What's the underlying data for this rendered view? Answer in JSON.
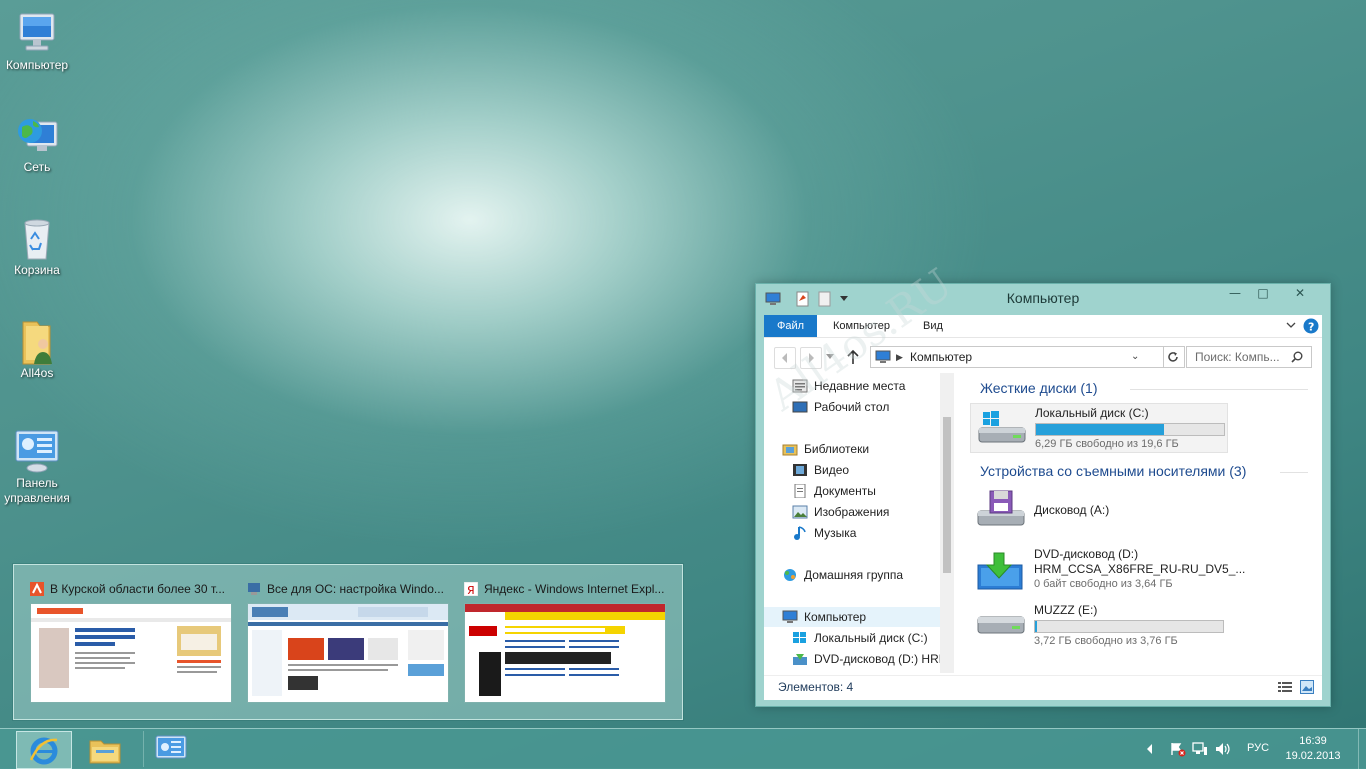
{
  "desktop": {
    "icons": [
      {
        "label": "Компьютер",
        "icon": "computer-icon"
      },
      {
        "label": "Сеть",
        "icon": "network-icon"
      },
      {
        "label": "Корзина",
        "icon": "recycle-bin-icon"
      },
      {
        "label": "All4os",
        "icon": "user-folder-icon"
      },
      {
        "label": "Панель управления",
        "icon": "control-panel-icon"
      }
    ],
    "watermark": "All4os.RU"
  },
  "previews": [
    {
      "title": "В Курской области более 30 т...",
      "icon": "news-site-icon",
      "accent": "#e8542a"
    },
    {
      "title": "Все для ОС: настройка Windo...",
      "icon": "all4os-site-icon",
      "accent": "#3a6ea5"
    },
    {
      "title": "Яндекс - Windows Internet Expl...",
      "icon": "yandex-icon",
      "accent": "#cc0000"
    }
  ],
  "window": {
    "title": "Компьютер",
    "ribbon_tabs": [
      "Файл",
      "Компьютер",
      "Вид"
    ],
    "address": "Компьютер",
    "search_placeholder": "Поиск: Компь...",
    "nav": [
      {
        "label": "Недавние места",
        "icon": "recent-places-icon"
      },
      {
        "label": "Рабочий стол",
        "icon": "desktop-icon"
      },
      {
        "label": "Библиотеки",
        "icon": "libraries-icon"
      },
      {
        "label": "Видео",
        "icon": "video-icon"
      },
      {
        "label": "Документы",
        "icon": "documents-icon"
      },
      {
        "label": "Изображения",
        "icon": "images-icon"
      },
      {
        "label": "Музыка",
        "icon": "music-icon"
      },
      {
        "label": "Домашняя группа",
        "icon": "homegroup-icon"
      },
      {
        "label": "Компьютер",
        "icon": "computer-icon"
      },
      {
        "label": "Локальный диск (C:)",
        "icon": "local-disk-icon"
      },
      {
        "label": "DVD-дисковод (D:) HRM",
        "icon": "dvd-drive-icon"
      }
    ],
    "groups": [
      {
        "title": "Жесткие диски (1)"
      },
      {
        "title": "Устройства со съемными носителями (3)"
      }
    ],
    "drives": [
      {
        "name": "Локальный диск (C:)",
        "free": "6,29 ГБ свободно из 19,6 ГБ",
        "used_fraction": 0.68,
        "icon": "hard-disk-icon"
      },
      {
        "name": "Дисковод (A:)",
        "free": "",
        "icon": "floppy-drive-icon"
      },
      {
        "name": "DVD-дисковод (D:)",
        "sub": "HRM_CCSA_X86FRE_RU-RU_DV5_...",
        "free": "0 байт свободно из 3,64 ГБ",
        "icon": "dvd-install-icon"
      },
      {
        "name": "MUZZZ (E:)",
        "free": "3,72 ГБ свободно из 3,76 ГБ",
        "used_fraction": 0.01,
        "icon": "usb-drive-icon"
      }
    ],
    "status": "Элементов: 4"
  },
  "taskbar": {
    "buttons": [
      "internet-explorer-icon",
      "file-explorer-icon",
      "control-panel-icon"
    ],
    "language": "РУС",
    "time": "16:39",
    "date": "19.02.2013"
  }
}
